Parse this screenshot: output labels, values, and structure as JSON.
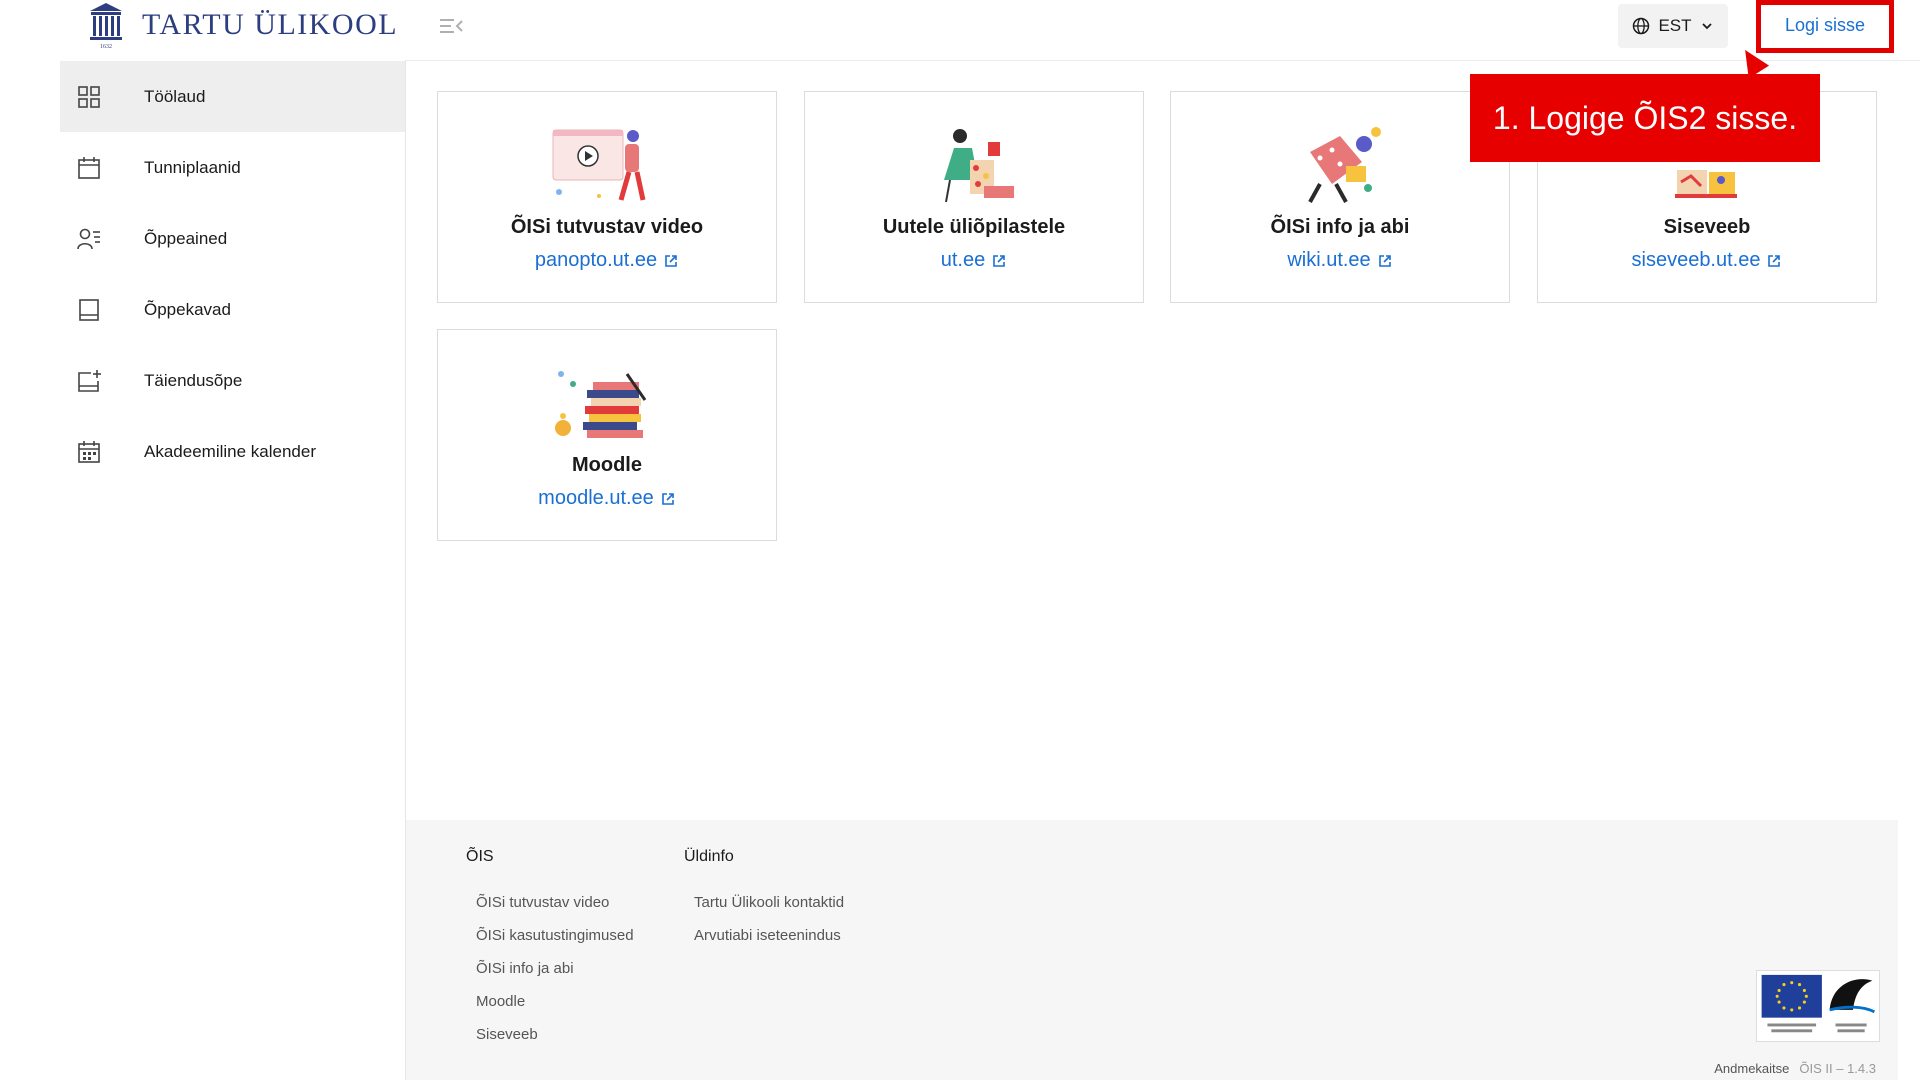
{
  "header": {
    "logo_text": "TARTU ÜLIKOOL",
    "logo_year": "1632",
    "language": "EST",
    "login_label": "Logi sisse"
  },
  "callout": {
    "text": "1. Logige ÕIS2 sisse."
  },
  "sidebar": {
    "items": [
      {
        "label": "Töölaud",
        "icon": "grid-icon",
        "active": true
      },
      {
        "label": "Tunniplaanid",
        "icon": "calendar-icon",
        "active": false
      },
      {
        "label": "Õppeained",
        "icon": "person-list-icon",
        "active": false
      },
      {
        "label": "Õppekavad",
        "icon": "book-icon",
        "active": false
      },
      {
        "label": "Täiendusõpe",
        "icon": "calendar-plus-icon",
        "active": false
      },
      {
        "label": "Akadeemiline kalender",
        "icon": "calendar-grid-icon",
        "active": false
      }
    ]
  },
  "cards": [
    {
      "title": "ÕISi tutvustav video",
      "link": "panopto.ut.ee"
    },
    {
      "title": "Uutele üliõpilastele",
      "link": "ut.ee"
    },
    {
      "title": "ÕISi info ja abi",
      "link": "wiki.ut.ee"
    },
    {
      "title": "Siseveeb",
      "link": "siseveeb.ut.ee"
    },
    {
      "title": "Moodle",
      "link": "moodle.ut.ee"
    }
  ],
  "footer": {
    "col1": {
      "heading": "ÕIS",
      "links": [
        "ÕISi tutvustav video",
        "ÕISi kasutustingimused",
        "ÕISi info ja abi",
        "Moodle",
        "Siseveeb"
      ]
    },
    "col2": {
      "heading": "Üldinfo",
      "links": [
        "Tartu Ülikooli kontaktid",
        "Arvutiabi iseteenindus"
      ]
    },
    "privacy": "Andmekaitse",
    "version": "ÕIS II – 1.4.3"
  },
  "colors": {
    "link": "#1a6fd4",
    "callout": "#e60000",
    "logo": "#2c3e80"
  }
}
